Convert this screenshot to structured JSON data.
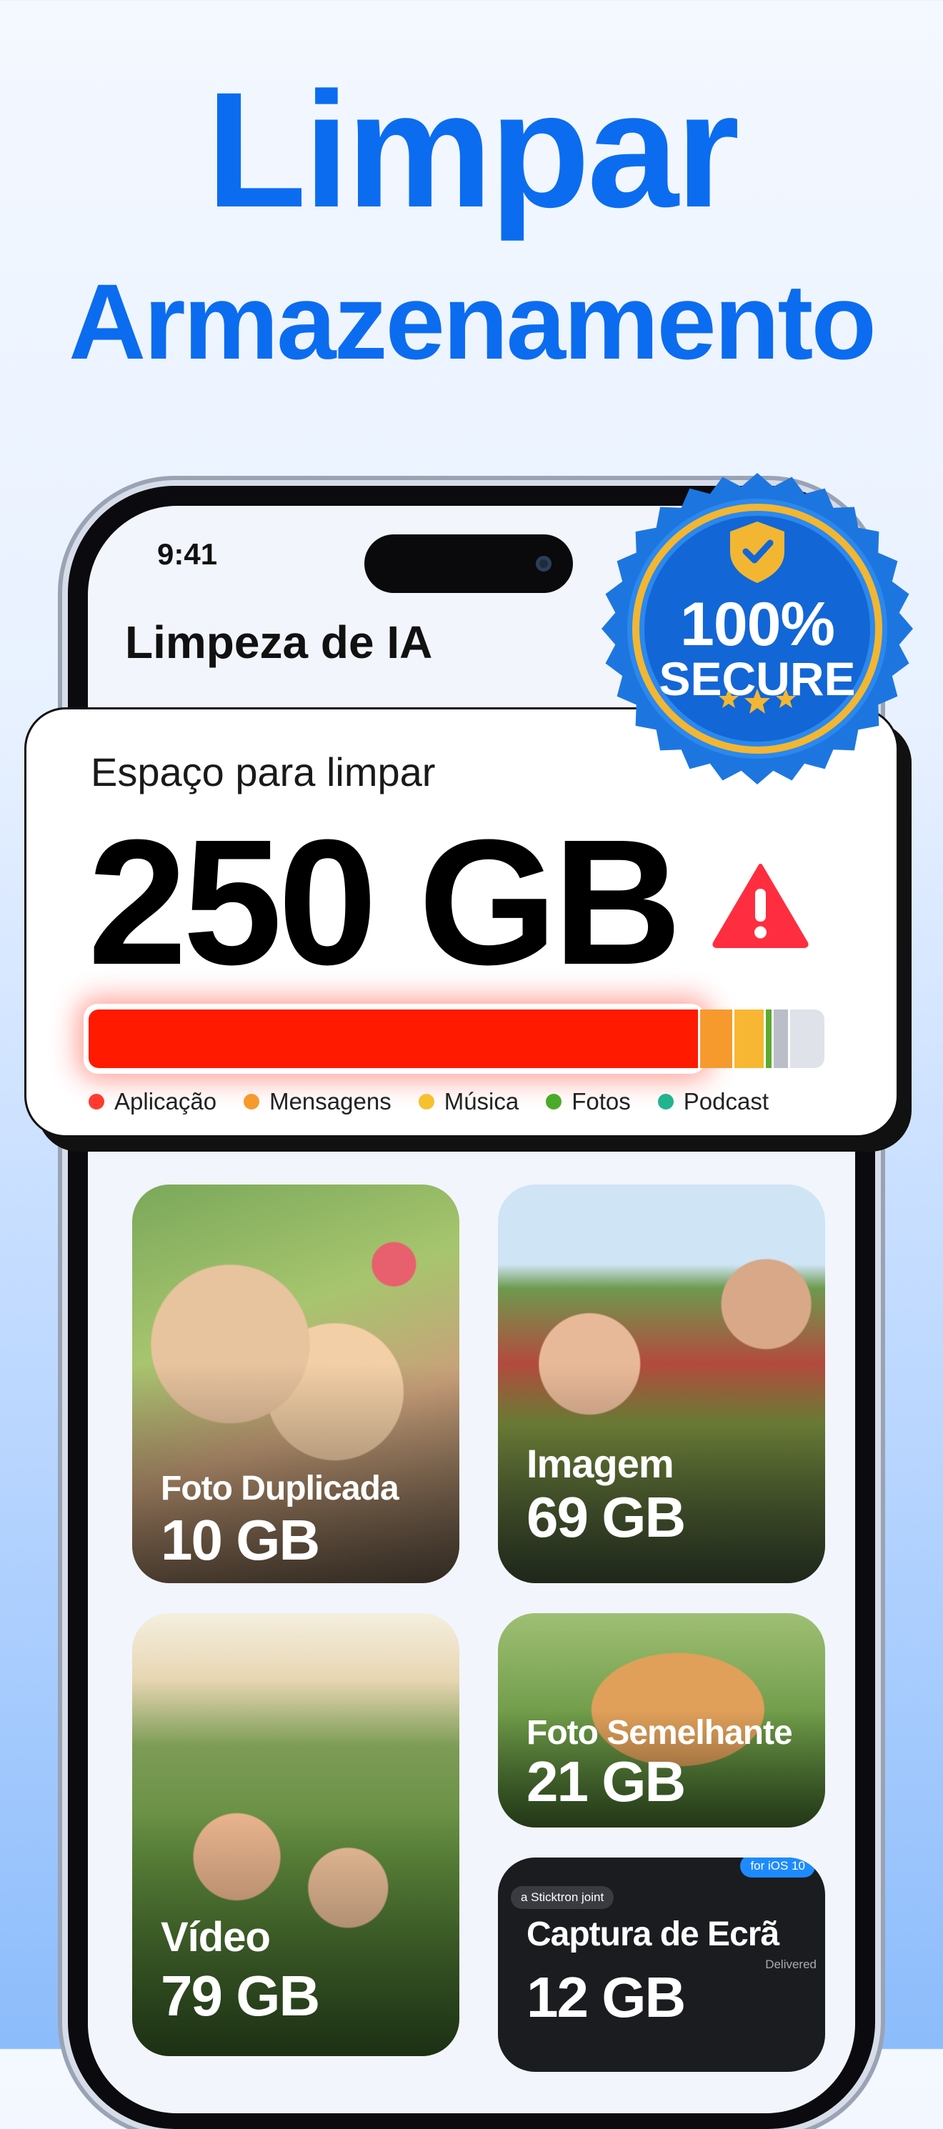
{
  "headline": {
    "line1": "Limpar",
    "line2": "Armazenamento"
  },
  "status_bar": {
    "time": "9:41"
  },
  "app": {
    "title": "Limpeza de IA"
  },
  "badge": {
    "percent": "100%",
    "label": "SECURE"
  },
  "storage": {
    "label": "Espaço para limpar",
    "value": "250 GB",
    "segments": [
      {
        "color": "#ff1a00",
        "fraction": 0.84
      },
      {
        "color": "#f79a2e",
        "fraction": 0.045
      },
      {
        "color": "#f7b733",
        "fraction": 0.04
      },
      {
        "color": "#5daa2f",
        "fraction": 0.008
      },
      {
        "color": "#b9bec8",
        "fraction": 0.02
      },
      {
        "color": "#dfe2e8",
        "fraction": 0.047
      }
    ],
    "legend": [
      {
        "label": "Aplicação",
        "color": "#ff3b30"
      },
      {
        "label": "Mensagens",
        "color": "#f79a2e"
      },
      {
        "label": "Música",
        "color": "#f7c02e"
      },
      {
        "label": "Fotos",
        "color": "#4caa2a"
      },
      {
        "label": "Podcast",
        "color": "#22b38f"
      }
    ]
  },
  "tiles": [
    {
      "label": "Foto Duplicada",
      "size": "10 GB"
    },
    {
      "label": "Imagem",
      "size": "69 GB"
    },
    {
      "label": "Vídeo",
      "size": "79 GB"
    },
    {
      "label": "Foto Semelhante",
      "size": "21 GB"
    },
    {
      "label": "Captura de Ecrã",
      "size": "12 GB",
      "chips": {
        "top": "for iOS 10",
        "left": "a Sticktron joint",
        "status": "Delivered"
      }
    }
  ]
}
